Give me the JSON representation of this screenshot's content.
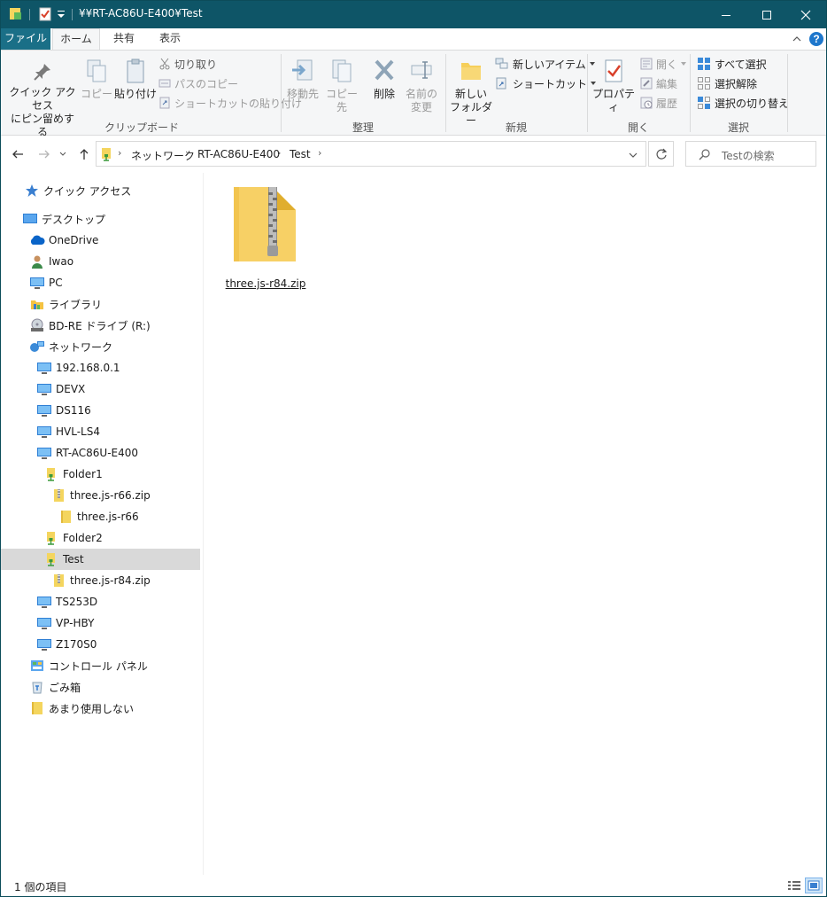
{
  "window": {
    "title": "¥¥RT-AC86U-E400¥Test"
  },
  "ribbon_tabs": [
    {
      "label": "ファイル"
    },
    {
      "label": "ホーム"
    },
    {
      "label": "共有"
    },
    {
      "label": "表示"
    }
  ],
  "ribbon": {
    "clipboard": {
      "pin_label_1": "クイック アクセス",
      "pin_label_2": "にピン留めする",
      "copy": "コピー",
      "paste": "貼り付け",
      "cut": "切り取り",
      "copy_path": "パスのコピー",
      "paste_shortcut": "ショートカットの貼り付け",
      "group": "クリップボード"
    },
    "organize": {
      "move_to": "移動先",
      "copy_to": "コピー先",
      "delete": "削除",
      "rename_1": "名前の",
      "rename_2": "変更",
      "group": "整理"
    },
    "new": {
      "new_folder_1": "新しい",
      "new_folder_2": "フォルダー",
      "new_item": "新しいアイテム",
      "shortcut": "ショートカット",
      "group": "新規"
    },
    "open": {
      "properties": "プロパティ",
      "open": "開く",
      "edit": "編集",
      "history": "履歴",
      "group": "開く"
    },
    "select": {
      "select_all": "すべて選択",
      "select_none": "選択解除",
      "invert": "選択の切り替え",
      "group": "選択"
    }
  },
  "address": {
    "crumbs": [
      "ネットワーク",
      "RT-AC86U-E400",
      "Test"
    ]
  },
  "search": {
    "placeholder": "Testの検索"
  },
  "nav": [
    {
      "label": "クイック アクセス",
      "icon": "star-icon"
    },
    {
      "label": "デスクトップ",
      "icon": "desktop-icon"
    },
    {
      "label": "OneDrive",
      "icon": "cloud-icon"
    },
    {
      "label": "Iwao",
      "icon": "user-icon"
    },
    {
      "label": "PC",
      "icon": "pc-icon"
    },
    {
      "label": "ライブラリ",
      "icon": "library-icon"
    },
    {
      "label": "BD-RE ドライブ (R:)",
      "icon": "disc-drive-icon"
    },
    {
      "label": "ネットワーク",
      "icon": "network-icon"
    },
    {
      "label": "192.168.0.1",
      "icon": "computer-icon"
    },
    {
      "label": "DEVX",
      "icon": "computer-icon"
    },
    {
      "label": "DS116",
      "icon": "computer-icon"
    },
    {
      "label": "HVL-LS4",
      "icon": "computer-icon"
    },
    {
      "label": "RT-AC86U-E400",
      "icon": "computer-icon"
    },
    {
      "label": "Folder1",
      "icon": "network-folder-icon"
    },
    {
      "label": "three.js-r66.zip",
      "icon": "zip-folder-icon"
    },
    {
      "label": "three.js-r66",
      "icon": "folder-icon"
    },
    {
      "label": "Folder2",
      "icon": "network-folder-icon"
    },
    {
      "label": "Test",
      "icon": "network-folder-icon"
    },
    {
      "label": "three.js-r84.zip",
      "icon": "zip-folder-icon"
    },
    {
      "label": "TS253D",
      "icon": "computer-icon"
    },
    {
      "label": "VP-HBY",
      "icon": "computer-icon"
    },
    {
      "label": "Z170S0",
      "icon": "computer-icon"
    },
    {
      "label": "コントロール パネル",
      "icon": "control-panel-icon"
    },
    {
      "label": "ごみ箱",
      "icon": "recycle-bin-icon"
    },
    {
      "label": "あまり使用しない",
      "icon": "folder-icon"
    }
  ],
  "files": [
    {
      "name": "three.js-r84.zip",
      "icon": "zip-folder-icon"
    }
  ],
  "status": {
    "items": "1 個の項目"
  },
  "colors": {
    "titlebar": "#0e5567",
    "file_tab": "#1a6f87",
    "selected": "#d9d9d9",
    "accent": "#0078d7"
  }
}
